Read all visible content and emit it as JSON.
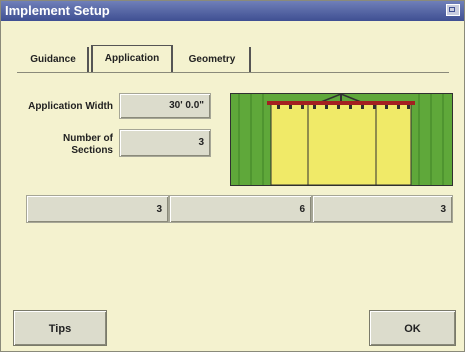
{
  "window": {
    "title": "Implement Setup"
  },
  "tabs": [
    {
      "label": "Guidance",
      "active": false
    },
    {
      "label": "Application",
      "active": true
    },
    {
      "label": "Geometry",
      "active": false
    }
  ],
  "form": {
    "application_width_label": "Application Width",
    "application_width_value": "30' 0.0\"",
    "sections_label_line1": "Number of",
    "sections_label_line2": "Sections",
    "sections_value": "3"
  },
  "section_widths": [
    "3",
    "6",
    "3"
  ],
  "buttons": {
    "tips_label": "Tips",
    "ok_label": "OK"
  },
  "colors": {
    "title_bar": "#3f4f92",
    "background": "#f4f2cf",
    "field_green": "#5fa83a",
    "section_yellow": "#f0ea68",
    "boom_red": "#a32020"
  },
  "icons": {
    "close": "window-close-icon"
  }
}
